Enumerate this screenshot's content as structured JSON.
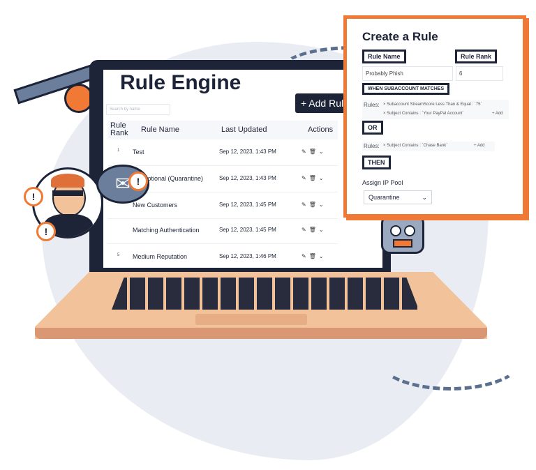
{
  "rule_engine": {
    "title": "Rule Engine",
    "add_button": "+ Add Rule",
    "search_placeholder": "Search by name",
    "columns": {
      "rank": "Rule Rank",
      "name": "Rule Name",
      "updated": "Last Updated",
      "actions": "Actions"
    },
    "rows": [
      {
        "rank": "1",
        "name": "Test",
        "updated": "Sep 12, 2023, 1:43 PM"
      },
      {
        "rank": "",
        "name": "Promotional (Quarantine)",
        "updated": "Sep 12, 2023, 1:43 PM"
      },
      {
        "rank": "",
        "name": "New Customers",
        "updated": "Sep 12, 2023, 1:45 PM"
      },
      {
        "rank": "",
        "name": "Matching Authentication",
        "updated": "Sep 12, 2023, 1:45 PM"
      },
      {
        "rank": "5",
        "name": "Medium Reputation",
        "updated": "Sep 12, 2023, 1:46 PM"
      }
    ]
  },
  "create_rule": {
    "title": "Create a Rule",
    "rule_name_label": "Rule Name",
    "rule_name_value": "Probably Phish",
    "rule_rank_label": "Rule Rank",
    "rule_rank_value": "6",
    "when_label": "WHEN SUBACCOUNT MATCHES",
    "rules_label": "Rules:",
    "group1": [
      "× Subaccount StreamScore Less Than & Equal : `75`",
      "× Subject Contains : `Your PayPal Account`"
    ],
    "or_label": "OR",
    "group2": [
      "× Subject Contains : `Chase Bank`"
    ],
    "add_label": "+ Add",
    "then_label": "THEN",
    "assign_label": "Assign IP Pool",
    "pool_value": "Quarantine"
  },
  "colors": {
    "accent": "#f07a35",
    "navy": "#1d2438",
    "laptop": "#f2c29b"
  }
}
